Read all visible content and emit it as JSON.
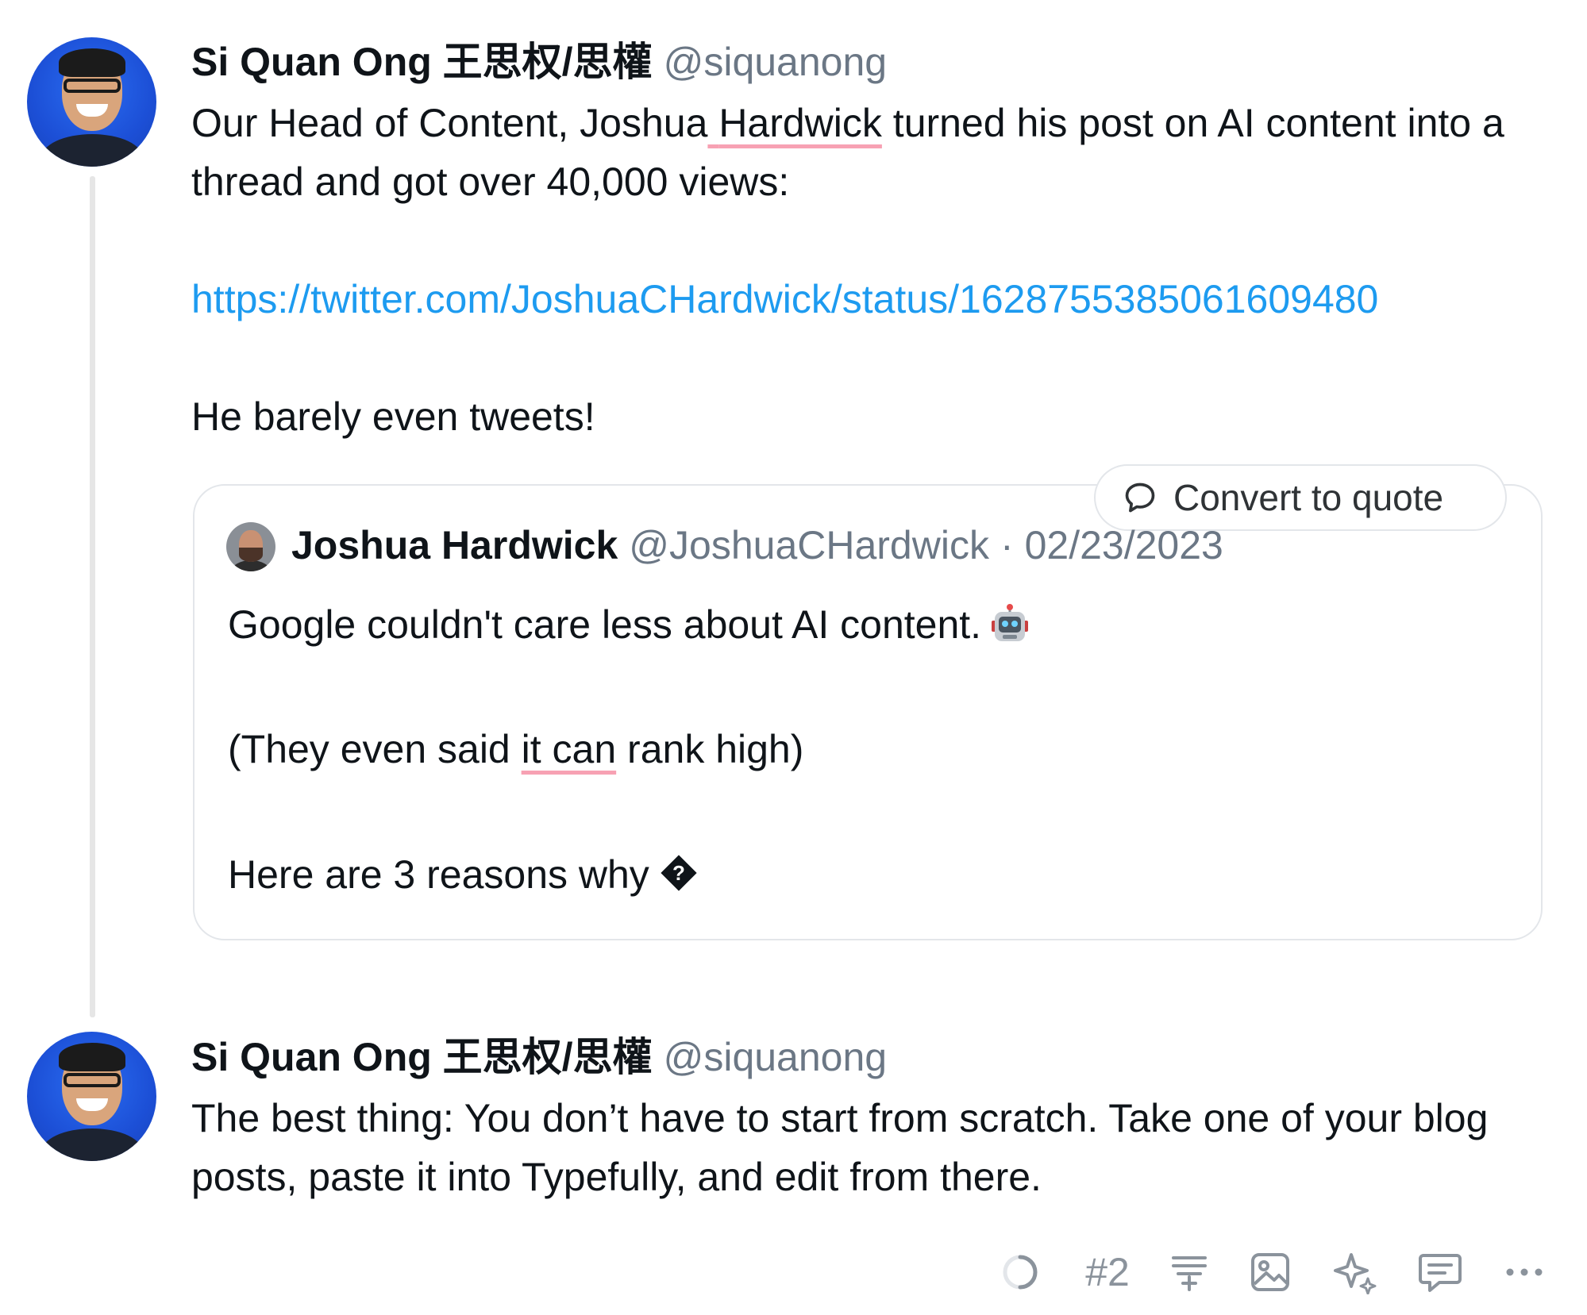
{
  "thread": [
    {
      "author": {
        "name": "Si Quan Ong 王思权/思權",
        "handle": "@siquanong"
      },
      "paragraphs": {
        "line1_a": "Our Head of Content, ",
        "line1_first": "Joshua",
        "line1_space": " ",
        "line1_last": "Hardwick",
        "line1_b": " turned his post on AI content into a thread and got over 40,000 views:",
        "link": "https://twitter.com/JoshuaCHardwick/status/1628755385061609480",
        "closing": "He barely even tweets!"
      },
      "quote": {
        "author_name": "Joshua Hardwick",
        "author_handle": "@JoshuaCHardwick",
        "separator": "·",
        "date": "02/23/2023",
        "line1": "Google couldn't care less about AI content.",
        "line2_a": "(They even said ",
        "line2_spell": "it can",
        "line2_b": " rank high)",
        "line3": "Here are 3 reasons why",
        "convert_label": "Convert to quote"
      }
    },
    {
      "author": {
        "name": "Si Quan Ong 王思权/思權",
        "handle": "@siquanong"
      },
      "text": "The best thing: You don’t have to start from scratch. Take one of your blog posts, paste it into Typefully, and edit from there."
    }
  ],
  "toolbar": {
    "tweet_number": "#2",
    "icons": [
      "progress-ring-icon",
      "split-icon",
      "image-icon",
      "sparkle-icon",
      "comment-icon",
      "more-icon"
    ]
  },
  "colors": {
    "link": "#1d9bf0",
    "handle": "#6b7785",
    "spellcheck_underline": "#f7a1b3",
    "avatar_bg": "#1c4fd6"
  }
}
